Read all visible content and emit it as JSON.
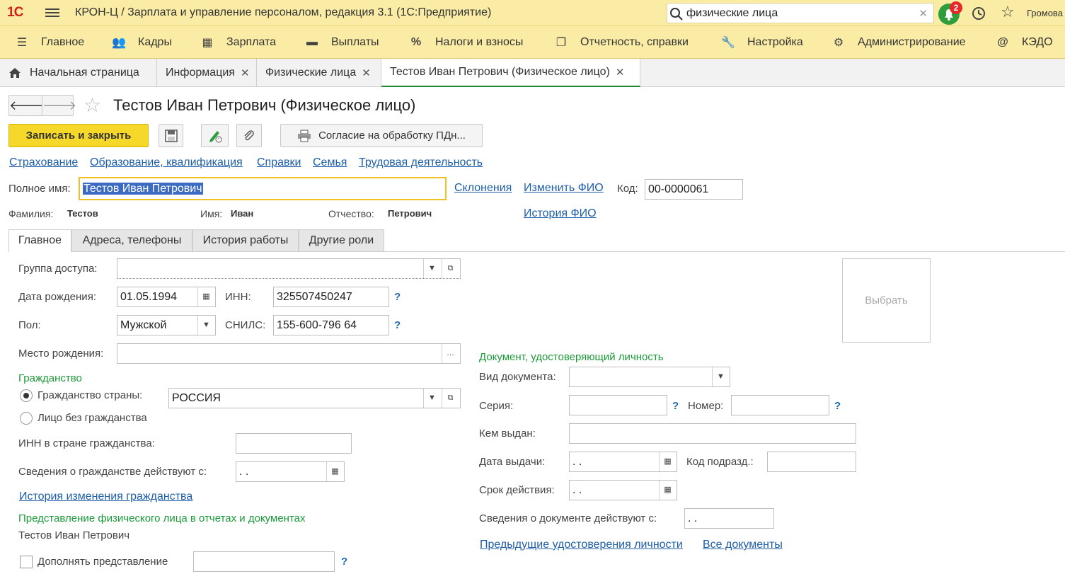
{
  "app": {
    "logo": "1С",
    "title": "КРОН-Ц / Зарплата и управление персоналом, редакция 3.1  (1С:Предприятие)",
    "search_value": "физические лица",
    "notifications_count": "2",
    "user": "Громова"
  },
  "sections": [
    {
      "label": "Главное",
      "icon": "menu-icon"
    },
    {
      "label": "Кадры",
      "icon": "people-icon"
    },
    {
      "label": "Зарплата",
      "icon": "calculator-icon"
    },
    {
      "label": "Выплаты",
      "icon": "wallet-icon"
    },
    {
      "label": "Налоги и взносы",
      "icon": "percent-icon"
    },
    {
      "label": "Отчетность, справки",
      "icon": "documents-icon"
    },
    {
      "label": "Настройка",
      "icon": "wrench-icon"
    },
    {
      "label": "Администрирование",
      "icon": "gear-icon"
    },
    {
      "label": "КЭДО",
      "icon": "at-icon"
    }
  ],
  "open_tabs": [
    {
      "label": "Начальная страница"
    },
    {
      "label": "Информация"
    },
    {
      "label": "Физические лица"
    },
    {
      "label": "Тестов Иван Петрович (Физическое лицо)"
    }
  ],
  "form": {
    "title": "Тестов Иван Петрович (Физическое лицо)",
    "save_close": "Записать и закрыть",
    "consent_button": "Согласие на обработку ПДн...",
    "links": [
      "Страхование",
      "Образование, квалификация",
      "Справки",
      "Семья",
      "Трудовая деятельность"
    ],
    "full_name_label": "Полное имя:",
    "full_name_value": "Тестов Иван Петрович",
    "declension_link": "Склонения",
    "change_name_link": "Изменить ФИО",
    "code_label": "Код:",
    "code_value": "00-0000061",
    "surname_label": "Фамилия:",
    "surname_value": "Тестов",
    "name_label": "Имя:",
    "name_value": "Иван",
    "patronymic_label": "Отчество:",
    "patronymic_value": "Петрович",
    "name_history_link": "История ФИО"
  },
  "inner_tabs": [
    "Главное",
    "Адреса, телефоны",
    "История работы",
    "Другие роли"
  ],
  "main": {
    "access_group_label": "Группа доступа:",
    "access_group_value": "",
    "birth_date_label": "Дата рождения:",
    "birth_date_value": "01.05.1994",
    "inn_label": "ИНН:",
    "inn_value": "325507450247",
    "gender_label": "Пол:",
    "gender_value": "Мужской",
    "snils_label": "СНИЛС:",
    "snils_value": "155-600-796 64",
    "birthplace_label": "Место рождения:",
    "birthplace_value": "",
    "citizenship_header": "Гражданство",
    "citizenship_country_label": "Гражданство страны:",
    "citizenship_country_value": "РОССИЯ",
    "stateless_label": "Лицо без гражданства",
    "foreign_inn_label": "ИНН в стране гражданства:",
    "citizenship_from_label": "Сведения о гражданстве действуют с:",
    "empty_date": " .  .",
    "citizenship_history_link": "История изменения гражданства",
    "presentation_header": "Представление физического лица в отчетах и документах",
    "presentation_value": "Тестов Иван Петрович",
    "extend_presentation_label": "Дополнять представление",
    "photo_button": "Выбрать",
    "help": "?"
  },
  "document": {
    "header": "Документ, удостоверяющий личность",
    "type_label": "Вид документа:",
    "series_label": "Серия:",
    "number_label": "Номер:",
    "issued_by_label": "Кем выдан:",
    "issue_date_label": "Дата выдачи:",
    "division_code_label": "Код подразд.:",
    "expiry_label": "Срок действия:",
    "valid_from_label": "Сведения о документе действуют с:",
    "prev_docs_link": "Предыдущие удостоверения личности",
    "all_docs_link": "Все документы"
  },
  "colors": {
    "accent_yellow": "#f6d82b",
    "header_bg": "#fbeca5",
    "link": "#1f5ea8",
    "group_green": "#1b9a3a"
  }
}
